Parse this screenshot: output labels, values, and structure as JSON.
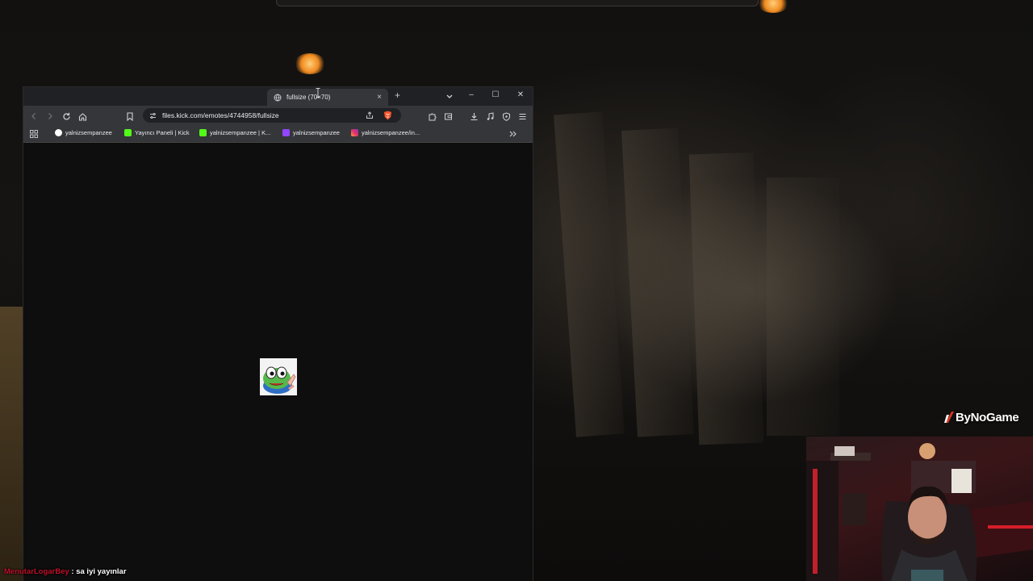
{
  "browser": {
    "tab_title": "fullsize (70×70)",
    "tab_close": "×",
    "new_tab": "+",
    "url": "files.kick.com/emotes/4744958/fullsize",
    "bookmarks": [
      {
        "label": "yalnizsempanzee",
        "icon": "google-icon",
        "color": "#4285f4"
      },
      {
        "label": "Yayıncı Paneli | Kick",
        "icon": "kick-icon",
        "color": "#53fc18"
      },
      {
        "label": "yalnizsempanzee | K...",
        "icon": "kick-icon",
        "color": "#53fc18"
      },
      {
        "label": "yalnizsempanzee",
        "icon": "twitch-icon",
        "color": "#9146ff"
      },
      {
        "label": "yalnizsempanzee/in...",
        "icon": "instagram-icon",
        "color": "#e1306c"
      }
    ],
    "window_controls": {
      "minimize": "–",
      "maximize": "☐",
      "close": "✕"
    }
  },
  "overlay": {
    "brand": "ByNoGame",
    "chat": {
      "user": "MenutarLogarBey",
      "separator": " : ",
      "message": "sa iyi yayınlar"
    }
  },
  "colors": {
    "kick_green": "#53fc18",
    "chat_user": "#c0102a",
    "brave_orange": "#fb542b"
  }
}
